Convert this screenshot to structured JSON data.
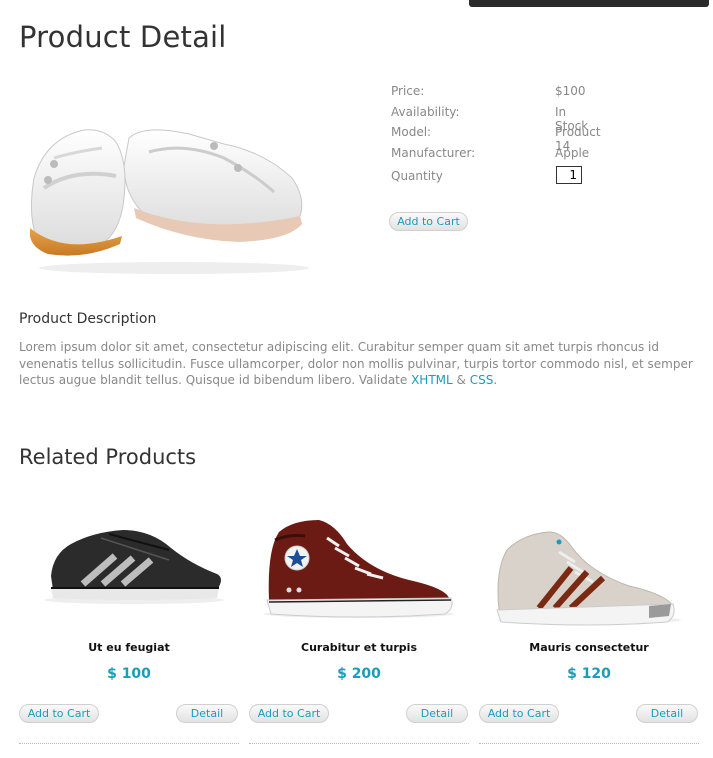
{
  "page": {
    "title": "Product Detail"
  },
  "product": {
    "image_icon": "white-flat-shoes-image",
    "specs": [
      {
        "label": "Price:",
        "value": "$100"
      },
      {
        "label": "Availability:",
        "value": "In Stock"
      },
      {
        "label": "Model:",
        "value": "Product 14"
      },
      {
        "label": "Manufacturer:",
        "value": "Apple"
      }
    ],
    "quantity_label": "Quantity",
    "quantity_value": "1",
    "add_to_cart_label": "Add to Cart"
  },
  "description": {
    "heading": "Product Description",
    "text": "Lorem ipsum dolor sit amet, consectetur adipiscing elit. Curabitur semper quam sit amet turpis rhoncus id venenatis tellus sollicitudin. Fusce ullamcorper, dolor non mollis pulvinar, turpis tortor commodo nisl, et semper lectus augue blandit tellus. Quisque id bibendum libero. Validate ",
    "link1": "XHTML",
    "amp": " & ",
    "link2": "CSS",
    "period": "."
  },
  "related": {
    "heading": "Related Products",
    "items": [
      {
        "name": "Ut eu feugiat",
        "price": "$ 100",
        "cart_label": "Add to Cart",
        "detail_label": "Detail",
        "image_icon": "black-sneaker-image"
      },
      {
        "name": "Curabitur et turpis",
        "price": "$ 200",
        "cart_label": "Add to Cart",
        "detail_label": "Detail",
        "image_icon": "red-hightop-sneaker-image"
      },
      {
        "name": "Mauris consectetur",
        "price": "$ 120",
        "cart_label": "Add to Cart",
        "detail_label": "Detail",
        "image_icon": "grey-hightop-sneaker-image"
      }
    ]
  },
  "colors": {
    "accent": "#1a9cbc",
    "muted_text": "#888888",
    "heading": "#333333"
  }
}
